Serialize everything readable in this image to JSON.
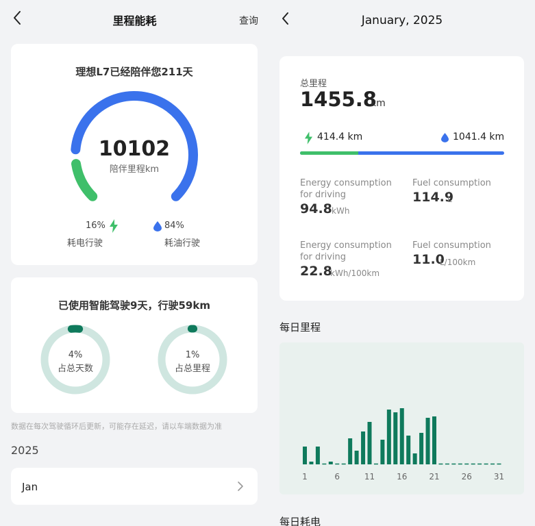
{
  "left": {
    "title": "里程能耗",
    "query": "查询",
    "companion": {
      "heading": "理想L7已经陪伴您211天",
      "mileage_value": "10102",
      "mileage_label": "陪伴里程km",
      "electric_pct": "16%",
      "electric_label": "耗电行驶",
      "fuel_pct": "84%",
      "fuel_label": "耗油行驶",
      "electric_share": 0.16
    },
    "smart_driving": {
      "heading": "已使用智能驾驶9天，行驶59km",
      "days_pct": "4%",
      "days_label": "占总天数",
      "mileage_pct": "1%",
      "mileage_label": "占总里程",
      "days_share": 0.04,
      "mileage_share": 0.01
    },
    "note": "数据在每次驾驶循环后更新，可能存在延迟，请以车端数据为准",
    "year": "2025",
    "month": "Jan"
  },
  "right": {
    "title": "January, 2025",
    "total_label": "总里程",
    "total_value": "1455.8",
    "total_unit": "km",
    "electric_km": "414.4 km",
    "fuel_km": "1041.4 km",
    "electric_share": 0.285,
    "metrics": [
      {
        "label": "Energy consumption for driving",
        "value": "94.8",
        "unit": "kWh"
      },
      {
        "label": "Fuel consumption",
        "value": "114.9",
        "unit": "L"
      },
      {
        "label": "Energy consumption for driving",
        "value": "22.8",
        "unit": "kWh/100km"
      },
      {
        "label": "Fuel consumption",
        "value": "11.0",
        "unit": "L/100km"
      }
    ],
    "daily_title": "每日里程",
    "daily_energy_title": "每日耗电"
  },
  "colors": {
    "blue": "#3a72ec",
    "green": "#3fbf6a",
    "teal": "#0f7a5c",
    "teal_light": "#cfe6e0"
  },
  "chart_data": {
    "type": "bar",
    "title": "每日里程",
    "x": [
      1,
      2,
      3,
      4,
      5,
      6,
      7,
      8,
      9,
      10,
      11,
      12,
      13,
      14,
      15,
      16,
      17,
      18,
      19,
      20,
      21,
      22,
      23,
      24,
      25,
      26,
      27,
      28,
      29,
      30,
      31
    ],
    "tick_labels": [
      "1",
      "6",
      "11",
      "16",
      "21",
      "26",
      "31"
    ],
    "values": [
      26,
      4,
      26,
      0,
      4,
      0,
      0,
      38,
      20,
      48,
      62,
      0,
      36,
      80,
      76,
      82,
      42,
      16,
      46,
      68,
      70,
      0,
      0,
      0,
      0,
      0,
      0,
      0,
      0,
      0,
      0
    ],
    "ylim": [
      0,
      100
    ]
  }
}
